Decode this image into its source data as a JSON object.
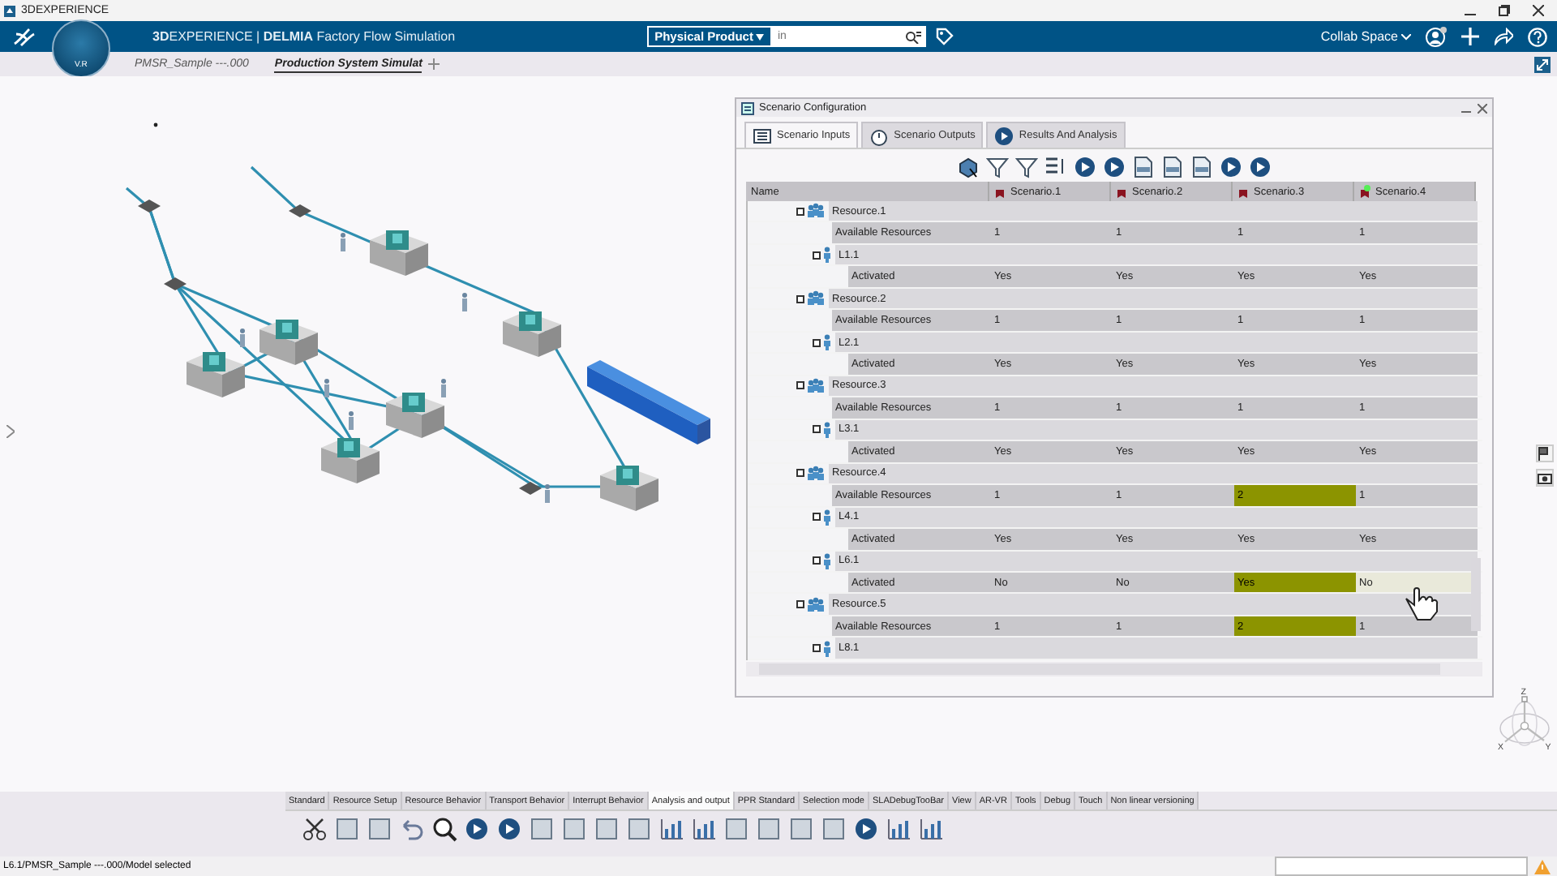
{
  "app_title": "3DEXPERIENCE",
  "header": {
    "brand": "**3D**EXPERIENCE | **DELMIA** Factory Flow Simulation",
    "compass_label": "V.R",
    "search": {
      "scope": "Physical Product",
      "placeholder": "in"
    },
    "collab_space": "Collab Space"
  },
  "doc_tabs": [
    {
      "label": "PMSR_Sample ---.000",
      "selected": false
    },
    {
      "label": "Production System Simulat",
      "selected": true
    }
  ],
  "scenario_panel": {
    "title": "Scenario Configuration",
    "tabs": [
      {
        "label": "Scenario Inputs",
        "selected": true
      },
      {
        "label": "Scenario Outputs",
        "selected": false
      },
      {
        "label": "Results And Analysis",
        "selected": false
      }
    ],
    "name_column": "Name",
    "scenarios": [
      {
        "label": "Scenario.1",
        "current": false
      },
      {
        "label": "Scenario.2",
        "current": false
      },
      {
        "label": "Scenario.3",
        "current": false
      },
      {
        "label": "Scenario.4",
        "current": true
      }
    ],
    "rows": [
      {
        "kind": "resource",
        "label": "Resource.1",
        "children": [
          {
            "kind": "param",
            "label": "Available Resources",
            "values": [
              "1",
              "1",
              "1",
              "1"
            ],
            "changed": [
              false,
              false,
              false,
              false
            ],
            "hovered": false
          },
          {
            "kind": "operator",
            "label": "L1.1",
            "children": [
              {
                "kind": "param",
                "label": "Activated",
                "values": [
                  "Yes",
                  "Yes",
                  "Yes",
                  "Yes"
                ],
                "changed": [
                  false,
                  false,
                  false,
                  false
                ],
                "hovered": false
              }
            ]
          }
        ]
      },
      {
        "kind": "resource",
        "label": "Resource.2",
        "children": [
          {
            "kind": "param",
            "label": "Available Resources",
            "values": [
              "1",
              "1",
              "1",
              "1"
            ],
            "changed": [
              false,
              false,
              false,
              false
            ],
            "hovered": false
          },
          {
            "kind": "operator",
            "label": "L2.1",
            "children": [
              {
                "kind": "param",
                "label": "Activated",
                "values": [
                  "Yes",
                  "Yes",
                  "Yes",
                  "Yes"
                ],
                "changed": [
                  false,
                  false,
                  false,
                  false
                ],
                "hovered": false
              }
            ]
          }
        ]
      },
      {
        "kind": "resource",
        "label": "Resource.3",
        "children": [
          {
            "kind": "param",
            "label": "Available Resources",
            "values": [
              "1",
              "1",
              "1",
              "1"
            ],
            "changed": [
              false,
              false,
              false,
              false
            ],
            "hovered": false
          },
          {
            "kind": "operator",
            "label": "L3.1",
            "children": [
              {
                "kind": "param",
                "label": "Activated",
                "values": [
                  "Yes",
                  "Yes",
                  "Yes",
                  "Yes"
                ],
                "changed": [
                  false,
                  false,
                  false,
                  false
                ],
                "hovered": false
              }
            ]
          }
        ]
      },
      {
        "kind": "resource",
        "label": "Resource.4",
        "children": [
          {
            "kind": "param",
            "label": "Available Resources",
            "values": [
              "1",
              "1",
              "2",
              "1"
            ],
            "changed": [
              false,
              false,
              true,
              false
            ],
            "hovered": false
          },
          {
            "kind": "operator",
            "label": "L4.1",
            "children": [
              {
                "kind": "param",
                "label": "Activated",
                "values": [
                  "Yes",
                  "Yes",
                  "Yes",
                  "Yes"
                ],
                "changed": [
                  false,
                  false,
                  false,
                  false
                ],
                "hovered": false
              }
            ]
          },
          {
            "kind": "operator",
            "label": "L6.1",
            "children": [
              {
                "kind": "param",
                "label": "Activated",
                "values": [
                  "No",
                  "No",
                  "Yes",
                  "No"
                ],
                "changed": [
                  false,
                  false,
                  true,
                  false
                ],
                "hovered": true
              }
            ]
          }
        ]
      },
      {
        "kind": "resource",
        "label": "Resource.5",
        "children": [
          {
            "kind": "param",
            "label": "Available Resources",
            "values": [
              "1",
              "1",
              "2",
              "1"
            ],
            "changed": [
              false,
              false,
              true,
              false
            ],
            "hovered": false
          },
          {
            "kind": "operator",
            "label": "L8.1"
          }
        ]
      }
    ]
  },
  "compass_axes": [
    "X",
    "Y",
    "Z"
  ],
  "action_bar": {
    "tabs": [
      {
        "label": "Standard",
        "selected": false
      },
      {
        "label": "Resource Setup",
        "selected": false
      },
      {
        "label": "Resource Behavior",
        "selected": false
      },
      {
        "label": "Transport Behavior",
        "selected": false
      },
      {
        "label": "Interrupt Behavior",
        "selected": false
      },
      {
        "label": "Analysis and output",
        "selected": true
      },
      {
        "label": "PPR Standard",
        "selected": false
      },
      {
        "label": "Selection mode",
        "selected": false
      },
      {
        "label": "SLADebugTooBar",
        "selected": false
      },
      {
        "label": "View",
        "selected": false
      },
      {
        "label": "AR-VR",
        "selected": false
      },
      {
        "label": "Tools",
        "selected": false
      },
      {
        "label": "Debug",
        "selected": false
      },
      {
        "label": "Touch",
        "selected": false
      },
      {
        "label": "Non linear versioning",
        "selected": false
      }
    ]
  },
  "status_bar": {
    "text": "L6.1/PMSR_Sample ---.000/Model selected"
  }
}
